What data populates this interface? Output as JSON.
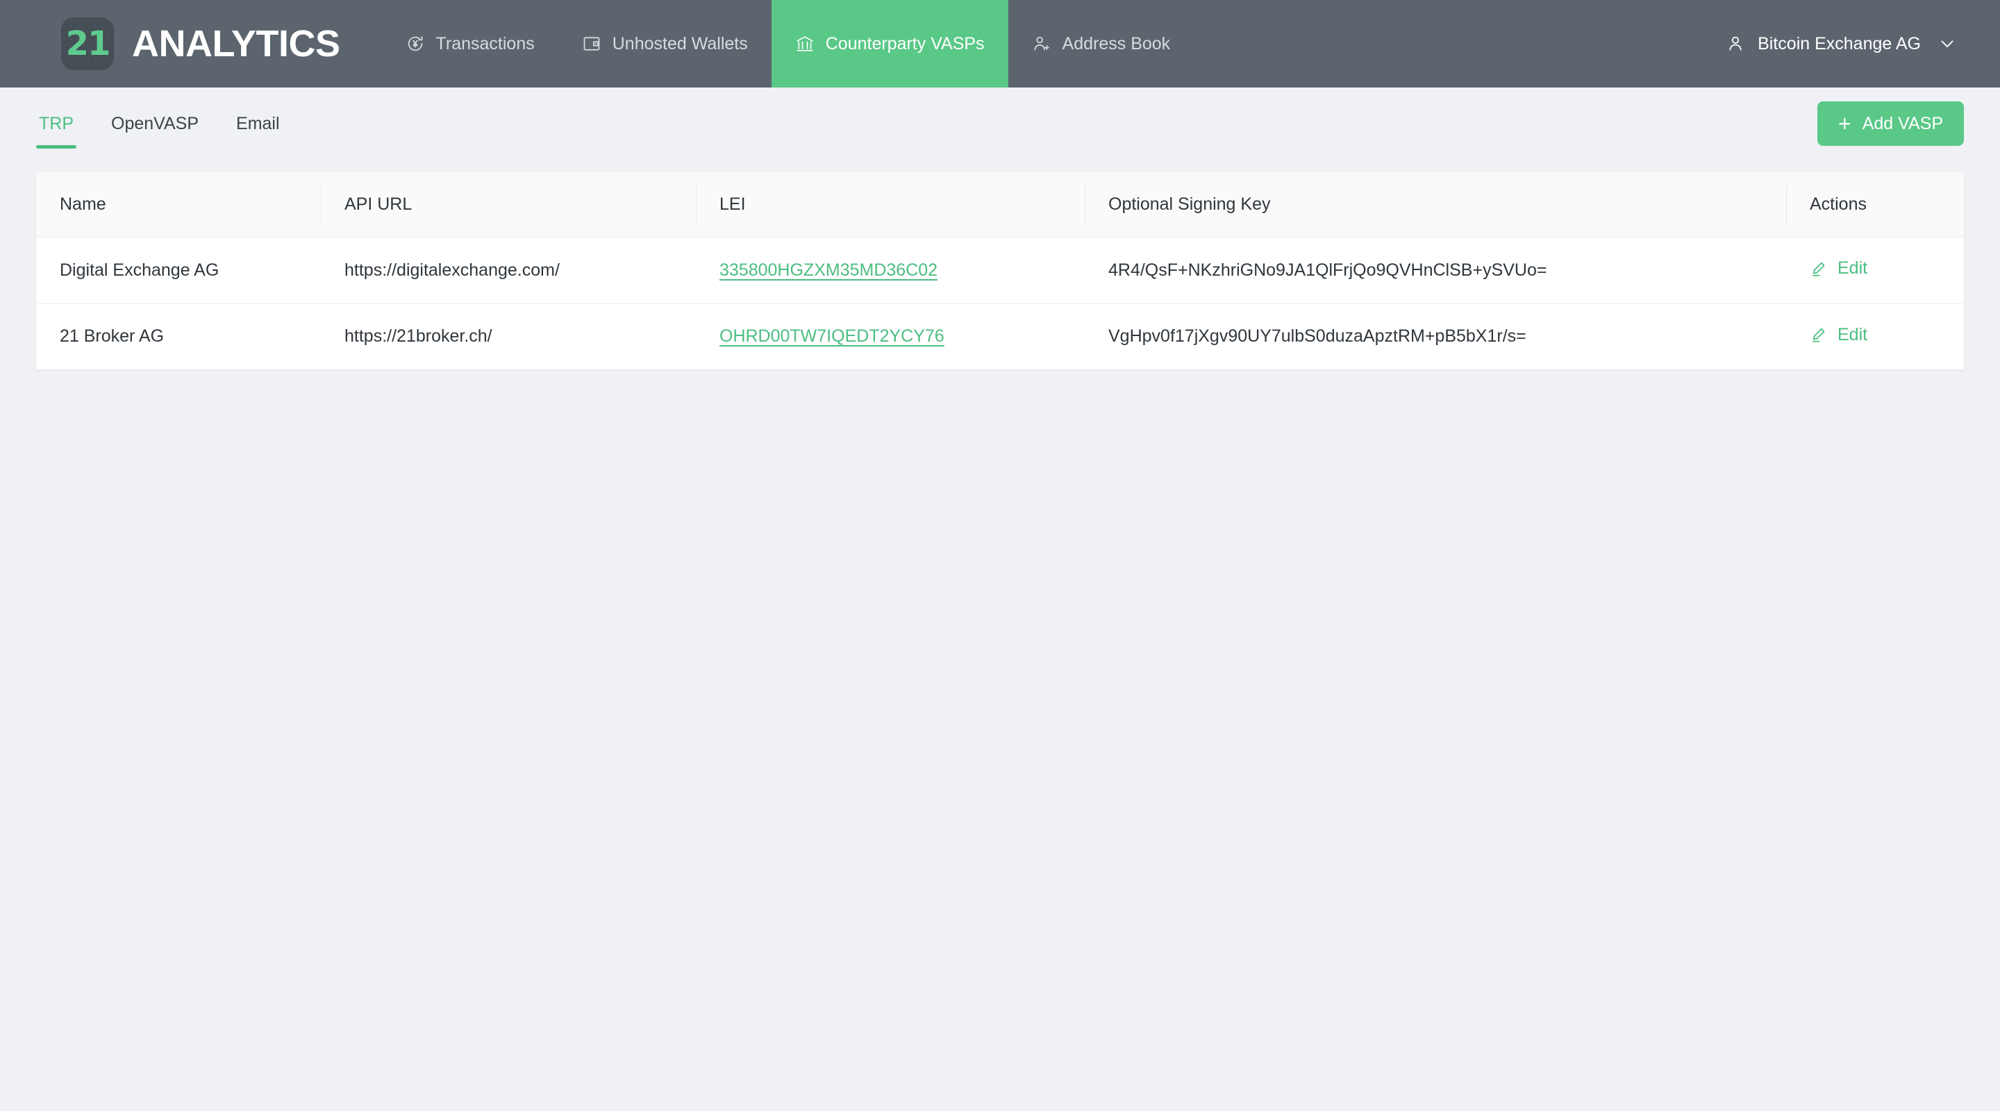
{
  "app": {
    "logo_mark": "21",
    "brand_name": "ANALYTICS"
  },
  "topnav": {
    "items": [
      {
        "label": "Transactions",
        "icon": "transactions-currency-refresh-icon",
        "active": false
      },
      {
        "label": "Unhosted Wallets",
        "icon": "wallet-icon",
        "active": false
      },
      {
        "label": "Counterparty VASPs",
        "icon": "bank-institution-icon",
        "active": true
      },
      {
        "label": "Address Book",
        "icon": "person-add-icon",
        "active": false
      }
    ],
    "user": {
      "name": "Bitcoin Exchange AG",
      "icon": "user-icon",
      "chevron": "chevron-down-icon"
    },
    "active_bg": "#5ac887",
    "bar_bg": "#5c656e"
  },
  "subnav": {
    "tabs": [
      {
        "label": "TRP",
        "active": true
      },
      {
        "label": "OpenVASP",
        "active": false
      },
      {
        "label": "Email",
        "active": false
      }
    ],
    "add_button": {
      "label": "Add VASP",
      "icon": "plus-icon",
      "color": "#5ac887"
    }
  },
  "table": {
    "columns": [
      "Name",
      "API URL",
      "LEI",
      "Optional Signing Key",
      "Actions"
    ],
    "rows": [
      {
        "name": "Digital Exchange AG",
        "api_url": "https://digitalexchange.com/",
        "lei": "335800HGZXM35MD36C02",
        "signing_key": "4R4/QsF+NKzhriGNo9JA1QlFrjQo9QVHnClSB+ySVUo=",
        "action_label": "Edit",
        "action_icon": "pencil-edit-icon"
      },
      {
        "name": "21 Broker AG",
        "api_url": "https://21broker.ch/",
        "lei": "OHRD00TW7IQEDT2YCY76",
        "signing_key": "VgHpv0f17jXgv90UY7ulbS0duzaApztRM+pB5bX1r/s=",
        "action_label": "Edit",
        "action_icon": "pencil-edit-icon"
      }
    ]
  },
  "theme": {
    "accent_green": "#5ac887",
    "link_green": "#4cbe81",
    "page_bg": "#eff1f5",
    "header_row_bg": "#fafafa",
    "text_dark": "#2f363c"
  }
}
